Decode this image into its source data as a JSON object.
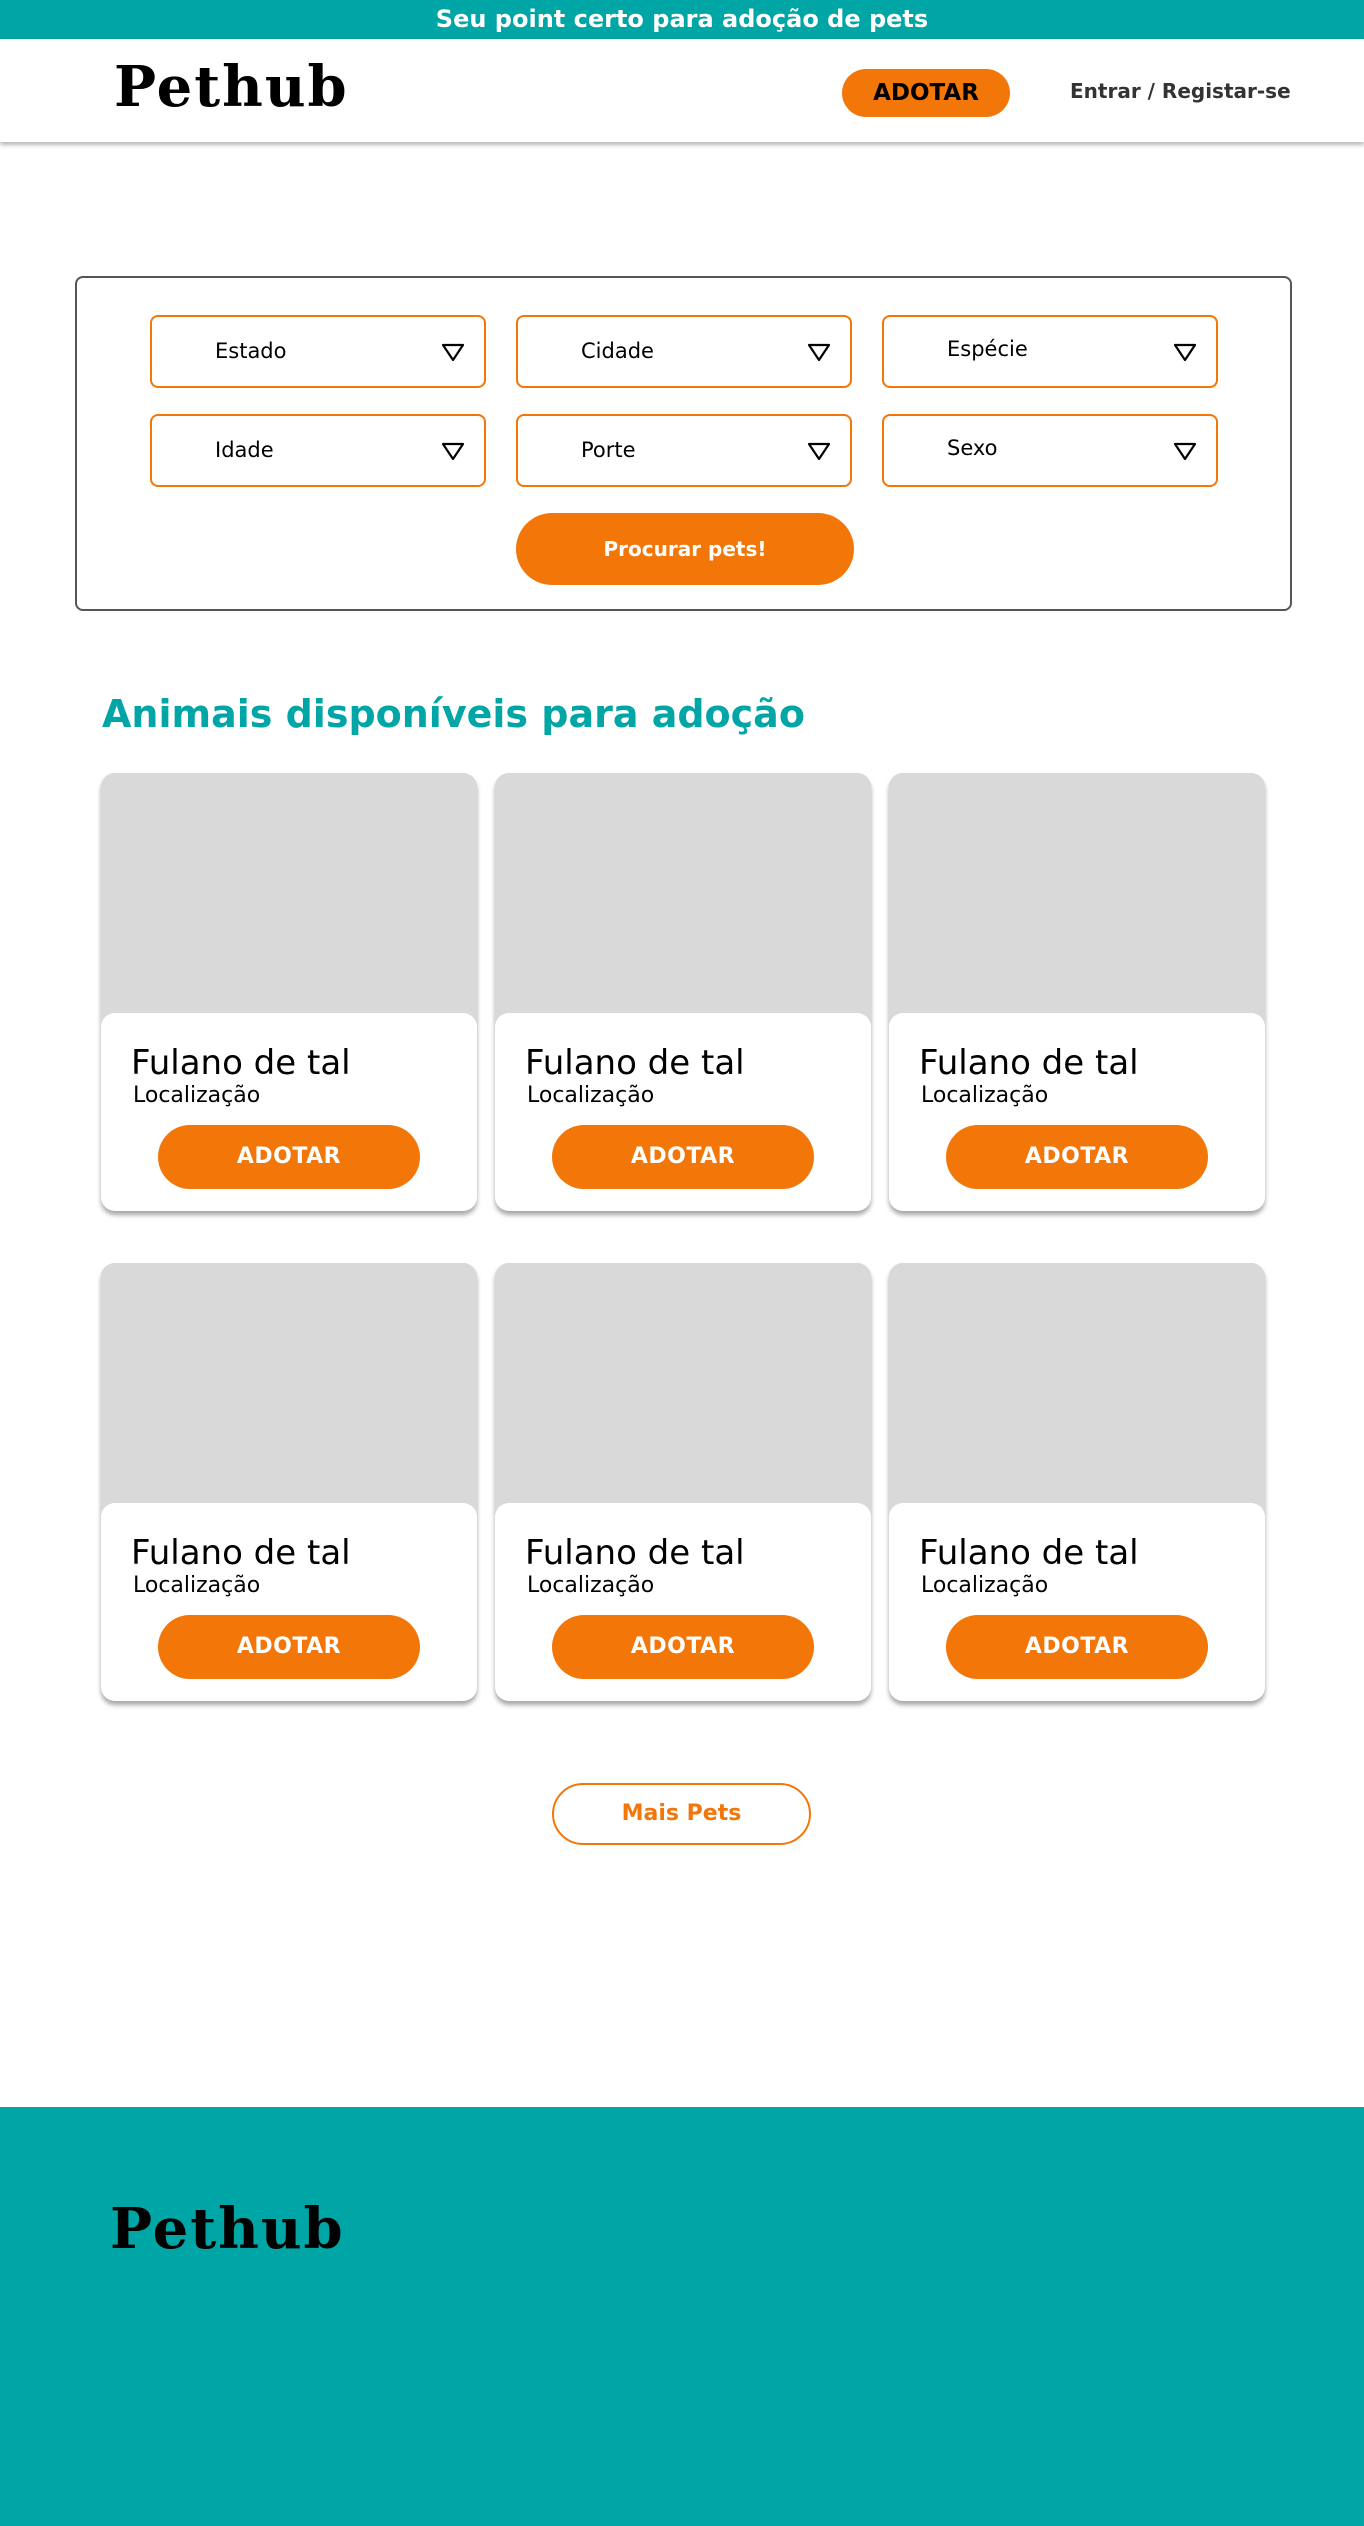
{
  "topbar": {
    "text": "Seu point certo para adoção de pets"
  },
  "header": {
    "logo": "Pethub",
    "adopt_label": "ADOTAR",
    "login_label": "Entrar / Registar-se"
  },
  "filters": {
    "estado": "Estado",
    "cidade": "Cidade",
    "especie": "Espécie",
    "idade": "Idade",
    "porte": "Porte",
    "sexo": "Sexo",
    "search_label": "Procurar pets!"
  },
  "section": {
    "title": "Animais disponíveis para adoção"
  },
  "cards": [
    {
      "name": "Fulano de tal",
      "location": "Localização",
      "button": "ADOTAR"
    },
    {
      "name": "Fulano de tal",
      "location": "Localização",
      "button": "ADOTAR"
    },
    {
      "name": "Fulano de tal",
      "location": "Localização",
      "button": "ADOTAR"
    },
    {
      "name": "Fulano de tal",
      "location": "Localização",
      "button": "ADOTAR"
    },
    {
      "name": "Fulano de tal",
      "location": "Localização",
      "button": "ADOTAR"
    },
    {
      "name": "Fulano de tal",
      "location": "Localização",
      "button": "ADOTAR"
    }
  ],
  "more": {
    "label": "Mais Pets"
  },
  "footer": {
    "logo": "Pethub"
  },
  "colors": {
    "brand_teal": "#00a5a6",
    "accent_orange": "#f37609",
    "placeholder_gray": "#d9d9d9"
  },
  "icons": {
    "select_chevron": "chevron-down-icon"
  }
}
